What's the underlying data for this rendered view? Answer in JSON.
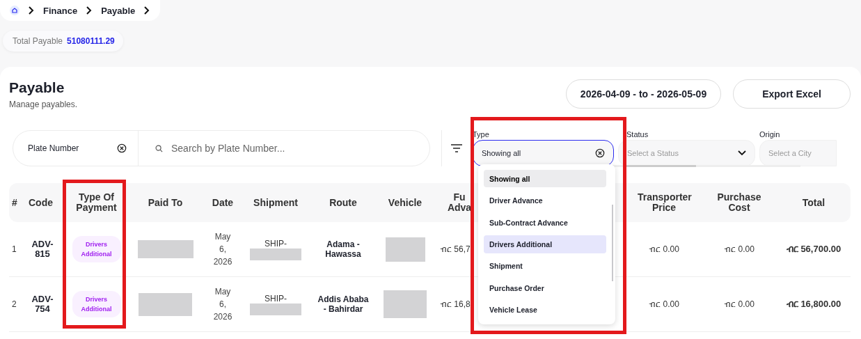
{
  "breadcrumb": [
    "Finance",
    "Payable"
  ],
  "total_payable": {
    "label": "Total Payable",
    "value": "51080111.29"
  },
  "header": {
    "title": "Payable",
    "subtitle": "Manage payables."
  },
  "actions": {
    "date_range": "2026-04-09 - to - 2026-05-09",
    "export": "Export Excel"
  },
  "filters": {
    "field_select": "Plate Number",
    "search_placeholder": "Search by Plate Number...",
    "type": {
      "label": "Type",
      "value": "Showing all",
      "focused": true
    },
    "status": {
      "label": "Status",
      "placeholder": "Select a Status"
    },
    "origin": {
      "label": "Origin",
      "placeholder": "Select a City"
    }
  },
  "type_options": [
    {
      "label": "Showing all",
      "selected": true,
      "highlighted": false
    },
    {
      "label": "Driver Advance",
      "selected": false,
      "highlighted": false
    },
    {
      "label": "Sub-Contract Advance",
      "selected": false,
      "highlighted": false
    },
    {
      "label": "Drivers Additional",
      "selected": false,
      "highlighted": true
    },
    {
      "label": "Shipment",
      "selected": false,
      "highlighted": false
    },
    {
      "label": "Purchase Order",
      "selected": false,
      "highlighted": false
    },
    {
      "label": "Vehicle Lease",
      "selected": false,
      "highlighted": false
    }
  ],
  "table": {
    "columns": [
      "#",
      "Code",
      "Type Of Payment",
      "Paid To",
      "Date",
      "Shipment",
      "Route",
      "Vehicle",
      "Fu Adva",
      "Transporter Price",
      "Purchase Cost",
      "Total"
    ],
    "rows": [
      {
        "number": "1",
        "code": "ADV-815",
        "type_of_payment": "Drivers Additional",
        "date": "May 6, 2026",
        "shipment": "SHIP-",
        "route": "Adama - Hawassa",
        "fuel_advance": "ብር 56,7",
        "transporter_price": "ብር 0.00",
        "purchase_cost": "ብር 0.00",
        "total": "ብር 56,700.00"
      },
      {
        "number": "2",
        "code": "ADV-754",
        "type_of_payment": "Drivers Additional",
        "date": "May 6, 2026",
        "shipment": "SHIP-",
        "route": "Addis Ababa - Bahirdar",
        "fuel_advance": "ብር 16,8",
        "transporter_price": "ብር 0.00",
        "purchase_cost": "ብር 0.00",
        "total": "ብር 16,800.00"
      }
    ]
  }
}
